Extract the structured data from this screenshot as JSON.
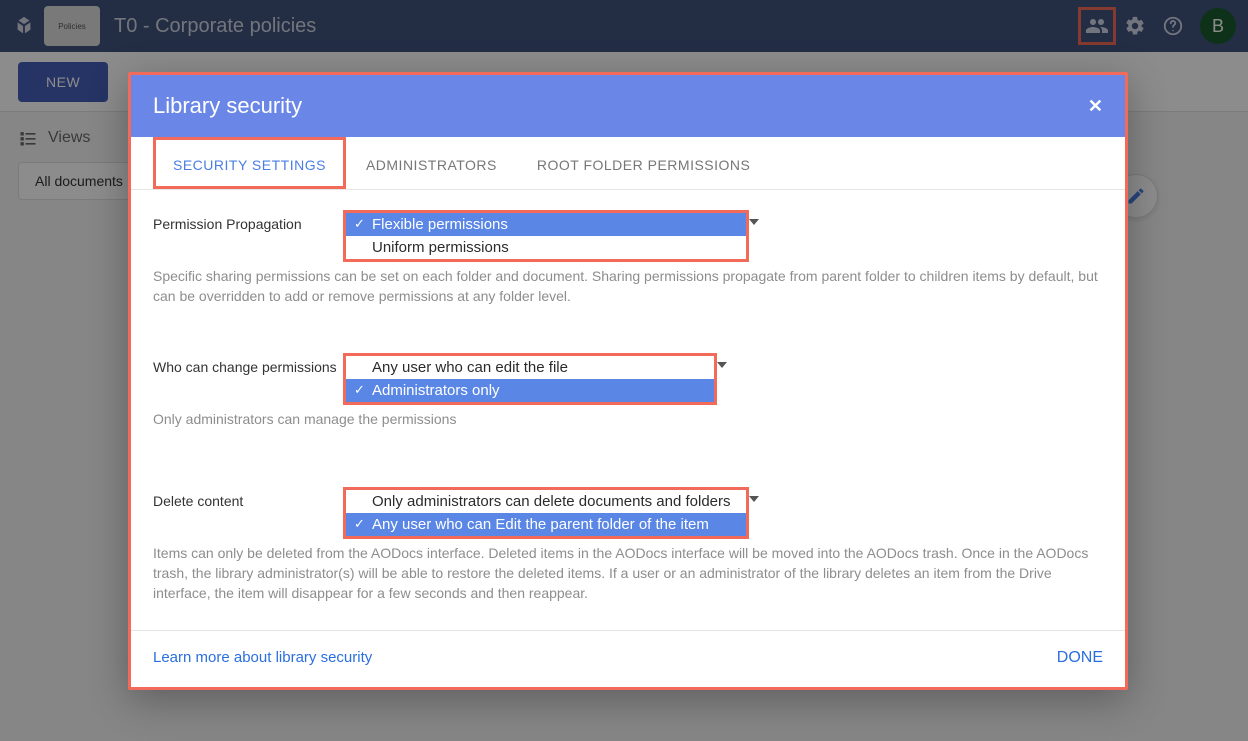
{
  "header": {
    "title": "T0 - Corporate policies",
    "thumb_label": "Policies",
    "avatar_initial": "B"
  },
  "subbar": {
    "new_label": "NEW"
  },
  "sidebar": {
    "views_label": "Views",
    "all_docs_label": "All documents"
  },
  "dialog": {
    "title": "Library security",
    "tabs": [
      {
        "label": "SECURITY SETTINGS"
      },
      {
        "label": "ADMINISTRATORS"
      },
      {
        "label": "ROOT FOLDER PERMISSIONS"
      }
    ],
    "sections": {
      "propagation": {
        "label": "Permission Propagation",
        "options": [
          "Flexible permissions",
          "Uniform permissions"
        ],
        "selected": 0,
        "desc": "Specific sharing permissions can be set on each folder and document. Sharing permissions propagate from parent folder to children items by default, but can be overridden to add or remove permissions at any folder level."
      },
      "change": {
        "label": "Who can change permissions",
        "options": [
          "Any user who can edit the file",
          "Administrators only"
        ],
        "selected": 1,
        "desc": "Only administrators can manage the permissions"
      },
      "delete": {
        "label": "Delete content",
        "options": [
          "Only administrators can delete documents and folders",
          "Any user who can Edit the parent folder of the item"
        ],
        "selected": 1,
        "desc": "Items can only be deleted from the AODocs interface. Deleted items in the AODocs interface will be moved into the AODocs trash. Once in the AODocs trash, the library administrator(s) will be able to restore the deleted items. If a user or an administrator of the library deletes an item from the Drive interface, the item will disappear for a few seconds and then reappear."
      }
    },
    "footer": {
      "learn_more": "Learn more about library security",
      "done": "DONE"
    }
  }
}
